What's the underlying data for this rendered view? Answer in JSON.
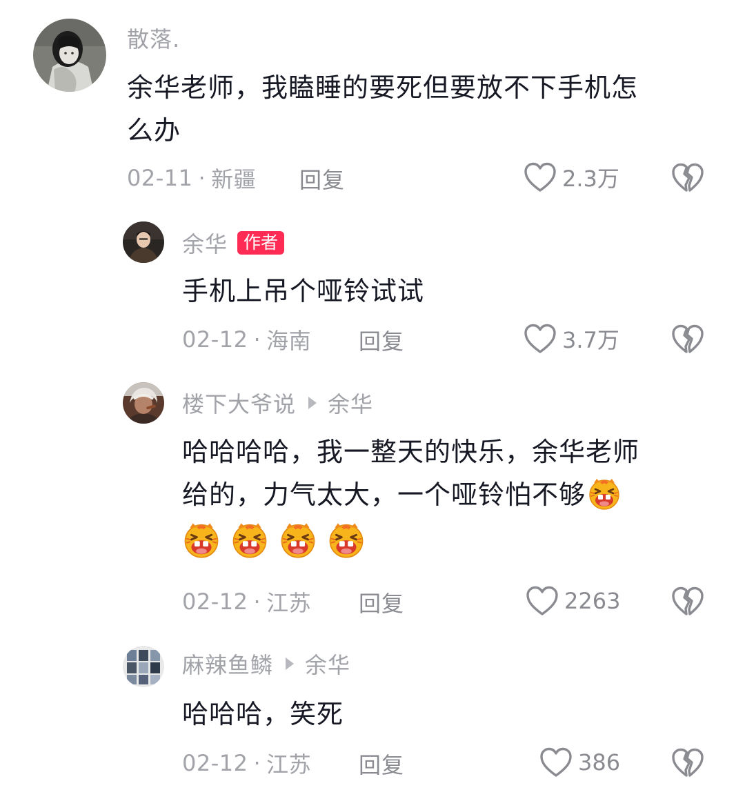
{
  "comments": [
    {
      "username": "散落.",
      "text_lines": [
        "余华老师，我瞌睡的要死但要放不下手机怎",
        "么办"
      ],
      "date": "02-11",
      "location": "新疆",
      "reply_label": "回复",
      "likes": "2.3万"
    },
    {
      "username": "余华",
      "badge": "作者",
      "text": "手机上吊个哑铃试试",
      "date": "02-12",
      "location": "海南",
      "reply_label": "回复",
      "likes": "3.7万"
    },
    {
      "username": "楼下大爷说",
      "reply_to": "余华",
      "text_lines": [
        "哈哈哈哈，我一整天的快乐，余华老师",
        "给的，力气太大，一个哑铃怕不够"
      ],
      "emoji_name": "laughing-tiger-emoji",
      "date": "02-12",
      "location": "江苏",
      "reply_label": "回复",
      "likes": "2263"
    },
    {
      "username": "麻辣鱼鳞",
      "reply_to": "余华",
      "text": "哈哈哈，笑死",
      "date": "02-12",
      "location": "江苏",
      "reply_label": "回复",
      "likes": "386"
    }
  ],
  "separator": "·",
  "icons": {
    "like": "heart-outline-icon",
    "dislike": "broken-heart-icon"
  },
  "colors": {
    "author_badge": "#fe2c55",
    "meta_text": "#a1a3a9",
    "body_text": "#161823"
  }
}
